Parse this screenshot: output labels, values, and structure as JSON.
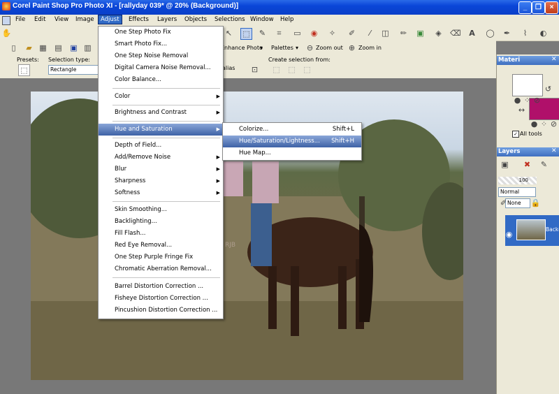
{
  "window": {
    "title": "Corel Paint Shop Pro Photo XI - [rallyday 039* @  20% (Background)]"
  },
  "menubar": [
    "File",
    "Edit",
    "View",
    "Image",
    "Adjust",
    "Effects",
    "Layers",
    "Objects",
    "Selections",
    "Window",
    "Help"
  ],
  "toolbar2": {
    "enhance_photo": "Enhance Photo",
    "palettes": "Palettes",
    "zoom_out": "Zoom out",
    "zoom_in": "Zoom in"
  },
  "tool_options": {
    "presets_label": "Presets:",
    "selection_type_label": "Selection type:",
    "selection_type_value": "Rectangle",
    "antialias_fragment": "alias",
    "create_selection_label": "Create selection from:"
  },
  "adjust_menu": [
    {
      "label": "One Step Photo Fix"
    },
    {
      "label": "Smart Photo Fix..."
    },
    {
      "label": "One Step Noise Removal"
    },
    {
      "label": "Digital Camera Noise Removal..."
    },
    {
      "label": "Color Balance..."
    },
    {
      "label": "Color",
      "submenu": true
    },
    {
      "label": "Brightness and Contrast",
      "submenu": true
    },
    {
      "label": "Hue and Saturation",
      "submenu": true,
      "highlighted": true
    },
    {
      "label": "Depth of Field..."
    },
    {
      "label": "Add/Remove Noise",
      "submenu": true
    },
    {
      "label": "Blur",
      "submenu": true
    },
    {
      "label": "Sharpness",
      "submenu": true
    },
    {
      "label": "Softness",
      "submenu": true
    },
    {
      "label": "Skin Smoothing..."
    },
    {
      "label": "Backlighting..."
    },
    {
      "label": "Fill Flash..."
    },
    {
      "label": "Red Eye Removal..."
    },
    {
      "label": "One Step Purple Fringe Fix"
    },
    {
      "label": "Chromatic Aberration Removal..."
    },
    {
      "label": "Barrel Distortion Correction ..."
    },
    {
      "label": "Fisheye Distortion Correction ..."
    },
    {
      "label": "Pincushion Distortion Correction ..."
    }
  ],
  "hue_submenu": [
    {
      "label": "Colorize...",
      "shortcut": "Shift+L"
    },
    {
      "label": "Hue/Saturation/Lightness...",
      "shortcut": "Shift+H",
      "highlighted": true
    },
    {
      "label": "Hue Map..."
    }
  ],
  "materials": {
    "title": "Materi",
    "all_tools": "All tools",
    "fg_color": "#ffffff",
    "bg_color": "#b0106a"
  },
  "layers": {
    "title": "Layers",
    "opacity": "100",
    "blend_mode": "Normal",
    "mask": "None",
    "layer_name": "Backg"
  },
  "photo_watermark": "RJB"
}
